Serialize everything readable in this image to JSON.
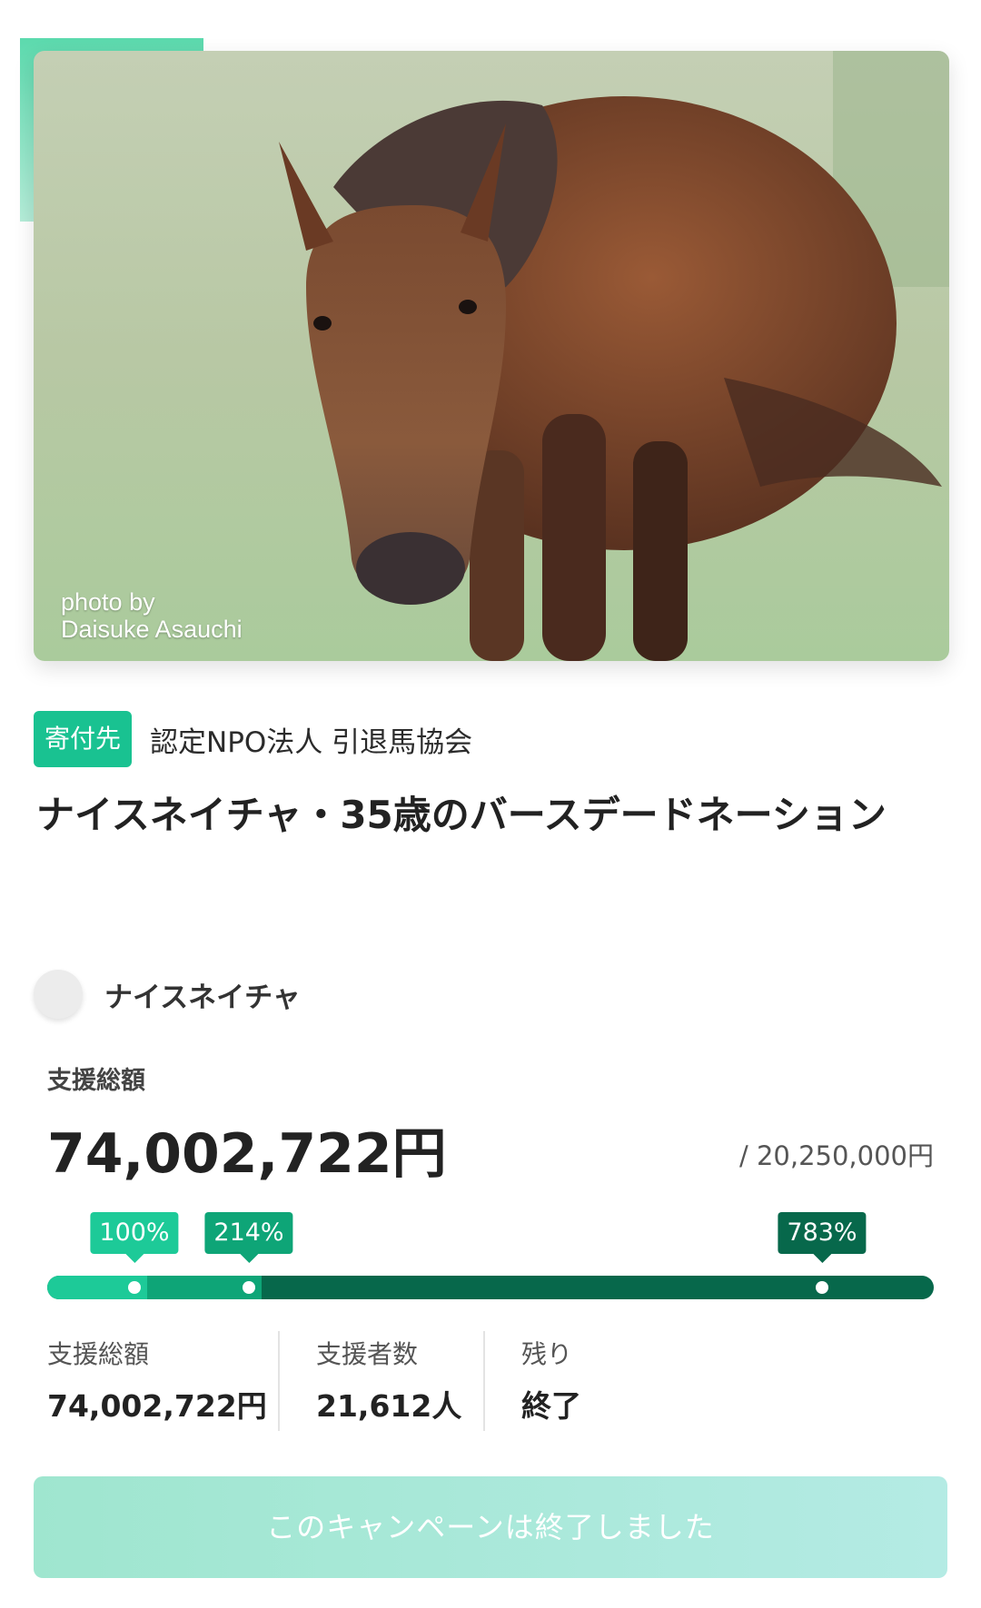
{
  "hero": {
    "photo_credit_line1": "photo by",
    "photo_credit_line2": "Daisuke Asauchi"
  },
  "recipient": {
    "tag": "寄付先",
    "name": "認定NPO法人 引退馬協会"
  },
  "campaign": {
    "title": "ナイスネイチャ・35歳のバースデードネーション"
  },
  "owner": {
    "name": "ナイスネイチャ"
  },
  "funding": {
    "total_label": "支援総額",
    "total_amount": "74,002,722円",
    "goal": "/ 20,250,000円",
    "progress_percent": 783,
    "milestones": [
      {
        "label": "100%",
        "percent": 100
      },
      {
        "label": "214%",
        "percent": 214
      },
      {
        "label": "783%",
        "percent": 783
      }
    ]
  },
  "stats": [
    {
      "label": "支援総額",
      "value": "74,002,722円"
    },
    {
      "label": "支援者数",
      "value": "21,612人"
    },
    {
      "label": "残り",
      "value": "終了"
    }
  ],
  "cta": {
    "label": "このキャンペーンは終了しました"
  },
  "colors": {
    "accent": "#19c291",
    "bar_dark": "#07684b",
    "bar_mid": "#0ea577",
    "bar_light": "#1dca98"
  }
}
